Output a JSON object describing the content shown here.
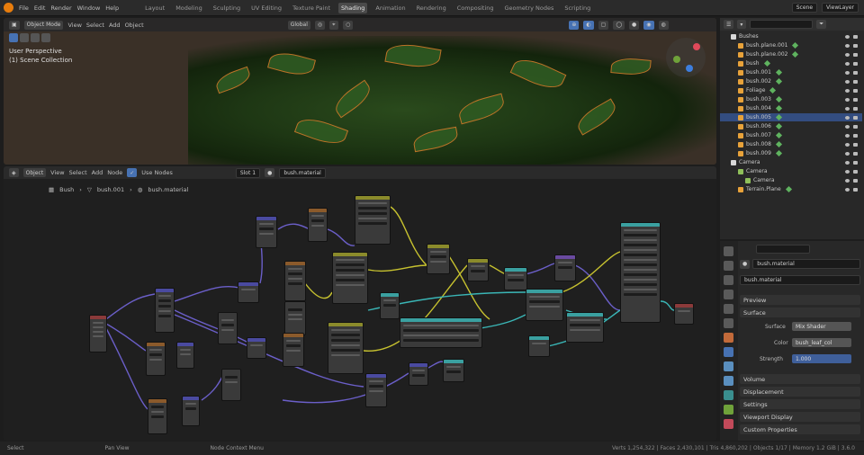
{
  "topbar": {
    "menus": [
      "File",
      "Edit",
      "Render",
      "Window",
      "Help"
    ],
    "workspaces": [
      "Layout",
      "Modeling",
      "Sculpting",
      "UV Editing",
      "Texture Paint",
      "Shading",
      "Animation",
      "Rendering",
      "Compositing",
      "Geometry Nodes",
      "Scripting"
    ],
    "active_workspace_index": 5,
    "scene_label": "Scene",
    "view_layer_label": "ViewLayer"
  },
  "viewport": {
    "header": [
      "Object Mode",
      "View",
      "Select",
      "Add",
      "Object"
    ],
    "transform": "Global",
    "info_line1": "User Perspective",
    "info_line2": "(1) Scene Collection"
  },
  "node_editor": {
    "header": [
      "Object",
      "View",
      "Select",
      "Add",
      "Node"
    ],
    "use_nodes_label": "Use Nodes",
    "slot_label": "Slot 1",
    "material_name": "bush.material",
    "breadcrumb": [
      "Bush",
      "bush.001",
      "bush.material"
    ]
  },
  "outliner": {
    "items": [
      {
        "label": "Bushes",
        "indent": 1,
        "type": "collection"
      },
      {
        "label": "bush.plane.001",
        "indent": 2,
        "type": "mesh"
      },
      {
        "label": "bush.plane.002",
        "indent": 2,
        "type": "mesh"
      },
      {
        "label": "bush",
        "indent": 2,
        "type": "mesh"
      },
      {
        "label": "bush.001",
        "indent": 2,
        "type": "mesh"
      },
      {
        "label": "bush.002",
        "indent": 2,
        "type": "mesh"
      },
      {
        "label": "Foliage",
        "indent": 2,
        "type": "mesh"
      },
      {
        "label": "bush.003",
        "indent": 2,
        "type": "mesh"
      },
      {
        "label": "bush.004",
        "indent": 2,
        "type": "mesh"
      },
      {
        "label": "bush.005",
        "indent": 2,
        "type": "mesh",
        "selected": true
      },
      {
        "label": "bush.006",
        "indent": 2,
        "type": "mesh"
      },
      {
        "label": "bush.007",
        "indent": 2,
        "type": "mesh"
      },
      {
        "label": "bush.008",
        "indent": 2,
        "type": "mesh"
      },
      {
        "label": "bush.009",
        "indent": 2,
        "type": "mesh"
      },
      {
        "label": "Camera",
        "indent": 1,
        "type": "collection"
      },
      {
        "label": "Camera",
        "indent": 2,
        "type": "camera"
      },
      {
        "label": "Camera",
        "indent": 3,
        "type": "camera"
      },
      {
        "label": "Terrain.Plane",
        "indent": 2,
        "type": "mesh"
      }
    ]
  },
  "properties": {
    "material_name": "bush.material",
    "panels": [
      "Preview",
      "Surface",
      "Volume",
      "Displacement",
      "Settings",
      "Viewport Display",
      "Custom Properties"
    ],
    "surface_label": "Surface",
    "surface_value": "Mix Shader",
    "color_label": "Color",
    "color_value": "bush_leaf_col",
    "strength_label": "Strength",
    "strength_value": "1.000"
  },
  "statusbar": {
    "left": "Select",
    "middle": "Pan View",
    "right_hint": "Node Context Menu",
    "stats": "Verts 1,254,322 | Faces 2,430,101 | Tris 4,860,202 | Objects 1/17 | Memory 1.2 GiB | 3.6.0"
  },
  "colors": {
    "accent": "#4772b3",
    "brand": "#e87d0d",
    "selection": "#334d80"
  }
}
